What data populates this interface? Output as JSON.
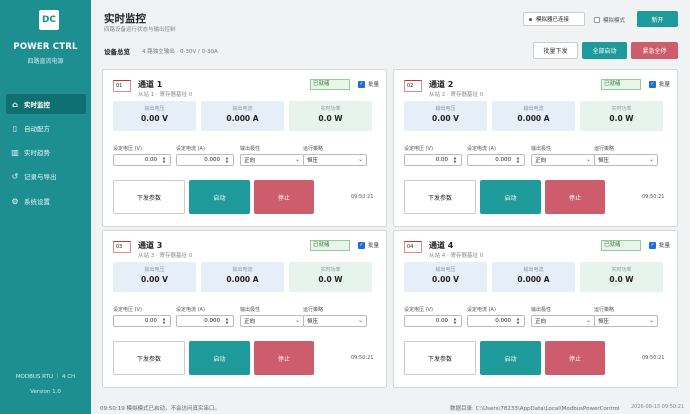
{
  "app": {
    "logo": "DC",
    "title": "POWER CTRL",
    "subtitle": "四路直流电源"
  },
  "nav": [
    {
      "label": "实时监控",
      "icon": "home-icon",
      "glyph": "⌂"
    },
    {
      "label": "自动配方",
      "icon": "clipboard-icon",
      "glyph": "▯"
    },
    {
      "label": "实时趋势",
      "icon": "chart-icon",
      "glyph": "▥"
    },
    {
      "label": "记录与导出",
      "icon": "history-icon",
      "glyph": "↺"
    },
    {
      "label": "系统设置",
      "icon": "gear-icon",
      "glyph": "⚙"
    }
  ],
  "sidebar_footer": {
    "protocol": "MODBUS RTU ｜ 4 CH",
    "version": "Version 1.0"
  },
  "header": {
    "title": "实时监控",
    "subtitle": "四路设备运行状态与输出控制",
    "connection": "模拟器已连接",
    "sim_mode": "模拟模式",
    "new_button": "新开"
  },
  "overview": {
    "label": "设备总览",
    "info": "4 路独立输出 · 0-30V / 0-30A",
    "batch_send": "批量下发",
    "all_start": "全部启动",
    "all_stop": "紧急全停"
  },
  "labels": {
    "voltage": "输出电压",
    "current": "输出电流",
    "power": "实时功率",
    "set_voltage": "设定电压 (V)",
    "set_current": "设定电流 (A)",
    "polarity": "输出极性",
    "strategy": "运行策略",
    "send": "下发参数",
    "start": "启动",
    "stop": "停止",
    "batch": "批量",
    "ready": "已就绪"
  },
  "channels": [
    {
      "badge": "01",
      "name": "通道 1",
      "sub": "从站 1 · 寄存器基址 0",
      "voltage": "0.00 V",
      "current": "0.000 A",
      "power": "0.0 W",
      "set_v": "0.00",
      "set_a": "0.000",
      "polarity": "正向",
      "strategy": "恒压",
      "time": "09:50:21"
    },
    {
      "badge": "02",
      "name": "通道 2",
      "sub": "从站 2 · 寄存器基址 0",
      "voltage": "0.00 V",
      "current": "0.000 A",
      "power": "0.0 W",
      "set_v": "0.00",
      "set_a": "0.000",
      "polarity": "正向",
      "strategy": "恒压",
      "time": "09:50:21"
    },
    {
      "badge": "03",
      "name": "通道 3",
      "sub": "从站 3 · 寄存器基址 0",
      "voltage": "0.00 V",
      "current": "0.000 A",
      "power": "0.0 W",
      "set_v": "0.00",
      "set_a": "0.000",
      "polarity": "正向",
      "strategy": "恒压",
      "time": "09:50:21"
    },
    {
      "badge": "04",
      "name": "通道 4",
      "sub": "从站 4 · 寄存器基址 0",
      "voltage": "0.00 V",
      "current": "0.000 A",
      "power": "0.0 W",
      "set_v": "0.00",
      "set_a": "0.000",
      "polarity": "正向",
      "strategy": "恒压",
      "time": "09:50:21"
    }
  ],
  "status": {
    "left": "09:50:19  模拟模式已启动，不会访问真实串口。",
    "right": "数据目录: C:\\Users\\78233\\AppData\\Local\\ModbusPowerControl",
    "time": "2026-08-13 09:50:21"
  },
  "colors": {
    "accent": "#1e9a9b",
    "sidebar": "#1e8f91",
    "danger": "#cd5c6c"
  }
}
